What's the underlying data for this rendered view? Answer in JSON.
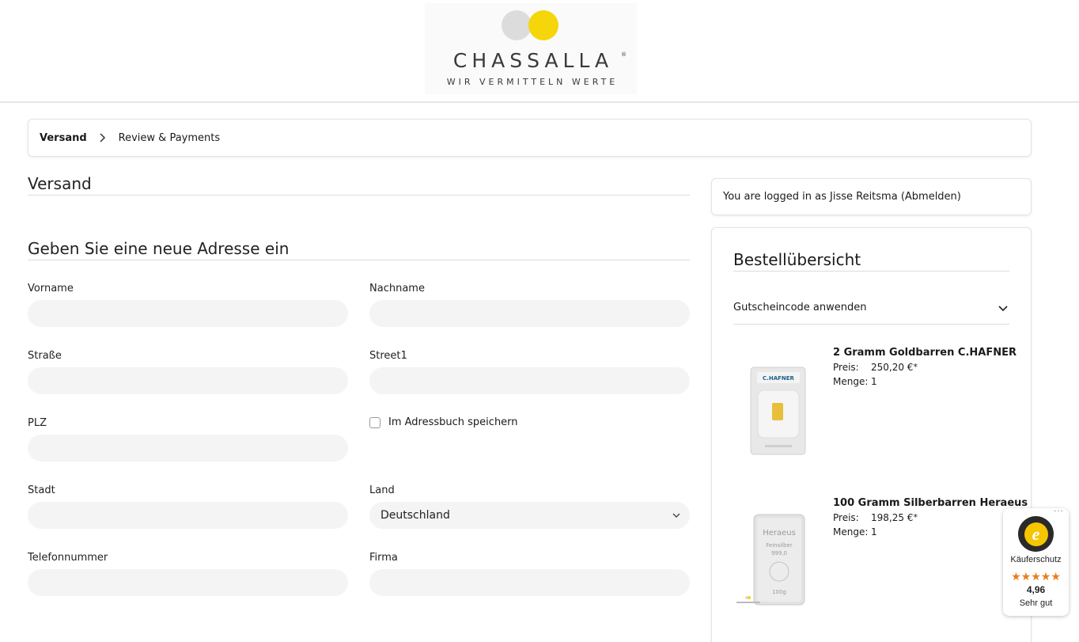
{
  "header": {
    "brand": "CHASSALLA",
    "registered": "®",
    "tagline": "WIR VERMITTELN WERTE"
  },
  "breadcrumb": {
    "step1": "Versand",
    "step2": "Review & Payments"
  },
  "shipping": {
    "title": "Versand",
    "new_address_title": "Geben Sie eine neue Adresse ein",
    "fields": {
      "firstname": {
        "label": "Vorname",
        "value": ""
      },
      "lastname": {
        "label": "Nachname",
        "value": ""
      },
      "street": {
        "label": "Straße",
        "value": ""
      },
      "street1": {
        "label": "Street1",
        "value": ""
      },
      "zip": {
        "label": "PLZ",
        "value": ""
      },
      "save_address": {
        "label": "Im Adressbuch speichern",
        "checked": false
      },
      "city": {
        "label": "Stadt",
        "value": ""
      },
      "country": {
        "label": "Land",
        "value": "Deutschland"
      },
      "phone": {
        "label": "Telefonnummer",
        "value": ""
      },
      "company": {
        "label": "Firma",
        "value": ""
      }
    }
  },
  "login": {
    "text": "You are logged in as Jisse Reitsma (Abmelden)"
  },
  "summary": {
    "title": "Bestellübersicht",
    "coupon_label": "Gutscheincode anwenden",
    "price_label": "Preis:",
    "qty_label": "Menge:",
    "asterisk": "*",
    "items": [
      {
        "name": "2 Gramm Goldbarren C.HAFNER",
        "price": "250,20 €",
        "qty": "1",
        "img_brand": "C.HAFNER"
      },
      {
        "name": "100 Gramm Silberbarren Heraeus",
        "price": "198,25 €",
        "qty": "1",
        "img_brand": "Heraeus",
        "img_line1": "Feinsilber",
        "img_line2": "999,0",
        "img_weight": "100g"
      }
    ]
  },
  "trust_badge": {
    "seal_letter": "e",
    "label": "Käuferschutz",
    "stars": "★★★★★",
    "score": "4,96",
    "rating_text": "Sehr gut",
    "more": "···"
  },
  "colors": {
    "accent_yellow": "#f4d60a",
    "logo_grey": "#dcdcdc",
    "input_bg": "#f4f4f4",
    "star_orange": "#e97c1b"
  }
}
